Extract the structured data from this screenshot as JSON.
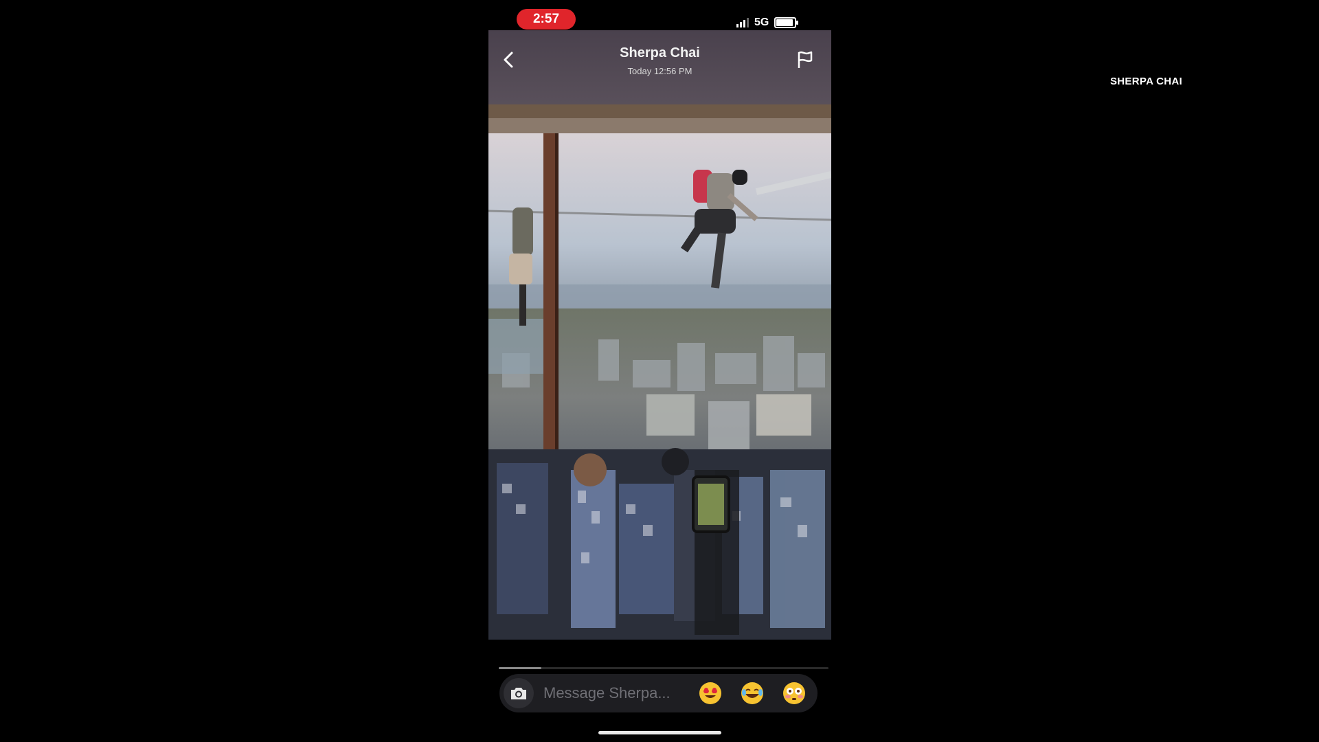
{
  "status_bar": {
    "time": "2:57",
    "network": "5G"
  },
  "header": {
    "contact_name": "Sherpa Chai",
    "timestamp": "Today 12:56 PM"
  },
  "story": {
    "progress": 0.13
  },
  "message_bar": {
    "placeholder": "Message Sherpa...",
    "emojis": [
      "heart-eyes-emoji-icon",
      "laughing-crying-emoji-icon",
      "flushed-emoji-icon"
    ]
  },
  "watermark": "SHERPA CHAI",
  "colors": {
    "time_pill": "#e0252b",
    "background": "#000000"
  }
}
